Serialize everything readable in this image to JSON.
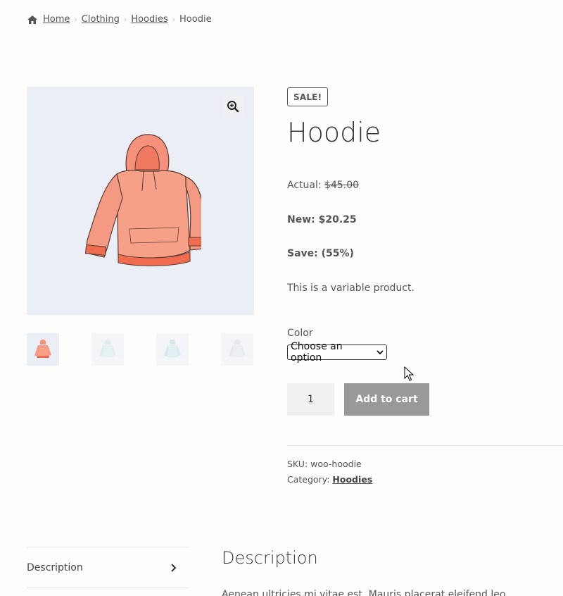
{
  "breadcrumb": {
    "items": [
      "Home",
      "Clothing",
      "Hoodies"
    ],
    "current": "Hoodie"
  },
  "gallery": {
    "zoom_icon": "zoom-in-icon",
    "thumbnail_count": 4
  },
  "product": {
    "badge": "SALE!",
    "title": "Hoodie",
    "actual_label": "Actual:",
    "actual_price": "$45.00",
    "new_text": "New: $20.25",
    "save_text": "Save: (55%)",
    "short_description": "This is a variable product.",
    "color_label": "Color",
    "color_select_value": "Choose an option",
    "quantity": "1",
    "add_to_cart": "Add to cart",
    "sku_label": "SKU:",
    "sku_value": "woo-hoodie",
    "category_label": "Category:",
    "category_value": "Hoodies"
  },
  "tabs": {
    "description_tab": "Description",
    "description_heading": "Description",
    "description_text": "Aenean ultricies mi vitae est. Mauris placerat eleifend leo."
  },
  "colors": {
    "accent_button": "#999999",
    "hoodie": "#f58d72",
    "gallery_bg": "#eceef5"
  }
}
